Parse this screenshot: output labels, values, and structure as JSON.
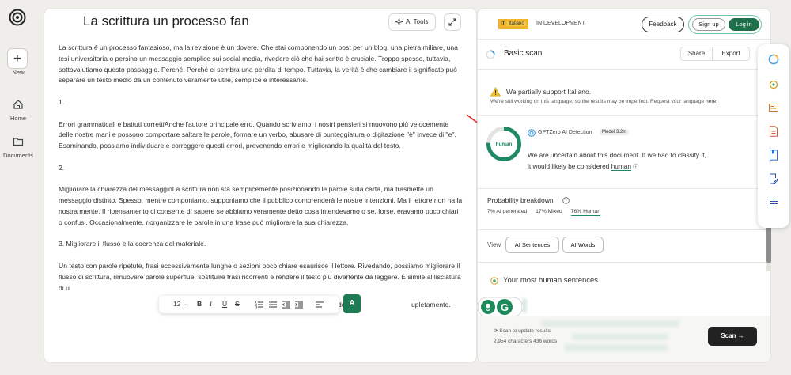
{
  "rail": {
    "new_label": "New",
    "home_label": "Home",
    "documents_label": "Documents"
  },
  "editor": {
    "title": "La scrittura  un processo fan",
    "ai_tools_label": "AI Tools",
    "paragraphs": [
      "La scrittura è un processo fantasioso, ma la revisione è un dovere. Che stai componendo un post per un blog, una pietra miliare, una tesi universitaria o persino un messaggio semplice sui social media, rivedere ciò che hai scritto è cruciale. Troppo spesso, tuttavia, sottovalutiamo questo passaggio. Perché. Perché ci sembra una perdita di tempo. Tuttavia, la verità è che cambiare il significato può separare un testo medio da un contenuto veramente utile, semplice e interessante.",
      "1.",
      "Errori grammaticali e battuti correttiAnche l'autore principale erro. Quando scriviamo, i nostri pensieri si muovono più velocemente delle nostre mani e possono comportare saltare le parole, formare un verbo, abusare di punteggiatura o digitazione \"è\" invece di \"e\". Esaminando, possiamo individuare e correggere questi errori, prevenendo errori e migliorando la qualità del testo.",
      "2.",
      "Migliorare la chiarezza del messaggioLa scrittura non sta semplicemente posizionando le parole sulla carta, ma trasmette un messaggio distinto. Spesso, mentre componiamo, supponiamo che il pubblico comprenderà le nostre intenzioni. Ma il lettore non ha la nostra mente. Il ripensamento ci consente di sapere se abbiamo veramente detto cosa intendevamo o se, forse, eravamo poco chiari o confusi. Occasionalmente, riorganizzare le parole in una frase può migliorare la sua chiarezza.",
      "3. Migliorare il flusso e la coerenza del materiale.",
      "Un testo con parole ripetute, frasi eccessivamente lunghe o sezioni poco chiare esaurisce il lettore. Rivedando, possiamo migliorare il flusso di scrittura, rimuovere parole superflue, sostituire frasi ricorrenti e rendere il testo più divertente da leggere. È simile al lisciatura di u",
      "de",
      "upletamento."
    ],
    "toolbar": {
      "font_size": "12",
      "bold": "B",
      "italic": "I",
      "underline": "U",
      "strike": "S"
    },
    "grammarly_label": "A"
  },
  "panel": {
    "lang_code": "IT",
    "lang_name": "Italiano",
    "dev_status": "IN DEVELOPMENT",
    "feedback_label": "Feedback",
    "signup_label": "Sign up",
    "login_label": "Log in",
    "scan_title": "Basic scan",
    "share_label": "Share",
    "export_label": "Export",
    "warning_title": "We partially support Italiano.",
    "warning_sub": "We're still working on this language, so the results may be imperfect. Request your language",
    "warning_link": "here.",
    "gauge_label": "human",
    "gauge_human_fraction": 0.76,
    "detector_name": "GPTZero AI Detection",
    "model_badge": "Model 3.2m",
    "verdict_a": "We are uncertain about this document. If we had to classify it, it would likely be considered",
    "verdict_b": "human",
    "breakdown_title": "Probability breakdown",
    "stat_ai": "7% AI generated",
    "stat_mixed": "17% Mixed",
    "stat_human": "76% Human",
    "view_label": "View",
    "ai_sentences_label": "AI Sentences",
    "ai_words_label": "AI Words",
    "human_sentences_title": "Your most human sentences",
    "update_text": "Scan to update results",
    "chars_text": "2,954 characters 436 words",
    "scan_button": "Scan"
  },
  "colors": {
    "accent_green": "#1f6f4a",
    "gauge_green": "#1f8a62",
    "badge_yellow": "#f0b429"
  }
}
